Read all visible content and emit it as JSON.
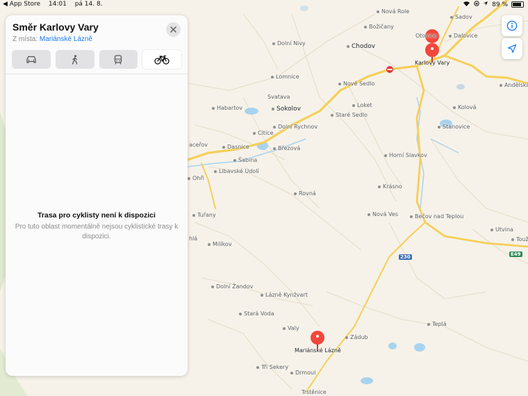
{
  "status_bar": {
    "back_app": "◀ App Store",
    "time": "14:01",
    "date": "pá 14. 8.",
    "battery_percent": "89 %",
    "battery_level": 0.89
  },
  "panel": {
    "title": "Směr Karlovy Vary",
    "from_prefix": "Z místa:",
    "origin": "Mariánské Lázně",
    "modes": [
      "car",
      "walk",
      "transit",
      "bike"
    ],
    "active_mode": "bike",
    "message_title": "Trasa pro cyklisty není k dispozici",
    "message_body": "Pro tuto oblast momentálně nejsou cyklistické trasy k dispozici."
  },
  "map": {
    "places": {
      "nova_role": "Nová Role",
      "sadov": "Sadov",
      "bozicany": "Božičany",
      "otovice": "Otovice",
      "dalovice": "Dalovice",
      "dolni_nivy": "Dolní Nivy",
      "chodov": "Chodov",
      "karlovy_vary": "Karlovy Vary",
      "lomnice": "Lomnice",
      "nove_sedlo": "Nové Sedlo",
      "andelska_hora": "Andělská H",
      "svatava": "Svatava",
      "habartov": "Habartov",
      "sokolov": "Sokolov",
      "loket": "Loket",
      "stare_sedlo": "Staré Sedlo",
      "kolova": "Kolová",
      "stanovice": "Stanovice",
      "citice": "Citice",
      "dolni_rychnov": "Dolní Rychnov",
      "dasnice": "Dasnice",
      "brezova": "Březová",
      "kacerov": "aceřov",
      "sabina": "Šabina",
      "horni_slavkov": "Horní Slavkov",
      "libavske_udoli": "Libavské Údolí",
      "ohri": "Ohři",
      "rovna": "Rovná",
      "krasno": "Krásno",
      "turany": "Tuřany",
      "nova_ves": "Nová Ves",
      "becov": "Bečov nad Teplou",
      "utvina": "Utvina",
      "touz": "Touž",
      "hla": "hlá",
      "milikov": "Milíkov",
      "dolni_zandov": "Dolní Žandov",
      "lazne_kynzvart": "Lázně Kynžvart",
      "stara_voda": "Stará Voda",
      "valy": "Valy",
      "marianske_lazne": "Mariánské Lázně",
      "zadub": "Zádub",
      "tepla": "Teplá",
      "tri_sekery": "Tři Sekery",
      "drmoul": "Drmoul",
      "trstenice": "Trstěnice"
    },
    "shields": {
      "route_230": "230",
      "route_e49": "E49"
    },
    "colors": {
      "pin": "#f2473c",
      "major_road": "#f5cf57",
      "water": "#a8d3ee",
      "origin_link": "#1c7cf0"
    }
  }
}
